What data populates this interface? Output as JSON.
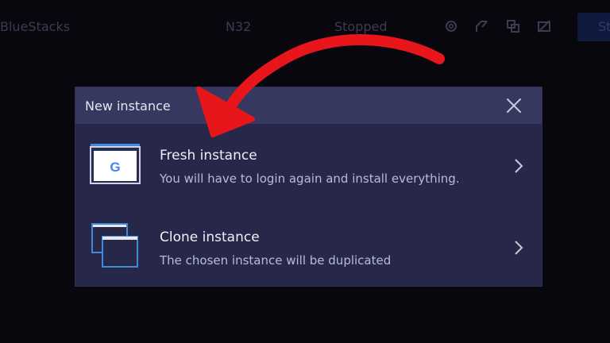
{
  "topbar": {
    "app_name": "BlueStacks",
    "instance_name": "N32",
    "instance_status": "Stopped",
    "start_label": "St",
    "icons": [
      "settings-icon",
      "shortcut-icon",
      "clone-window-icon",
      "eco-mode-icon"
    ]
  },
  "dialog": {
    "title": "New instance",
    "close_icon": "close-icon",
    "options": [
      {
        "title": "Fresh instance",
        "description": "You will have to login again and install everything.",
        "icon": "fresh-instance-icon"
      },
      {
        "title": "Clone instance",
        "description": "The chosen instance will be duplicated",
        "icon": "clone-instance-icon"
      }
    ]
  },
  "colors": {
    "background": "#07070d",
    "dialog_bg": "#272849",
    "dialog_header": "#363860",
    "accent_blue": "#3f8ad8",
    "annotation_red": "#e8161b"
  }
}
